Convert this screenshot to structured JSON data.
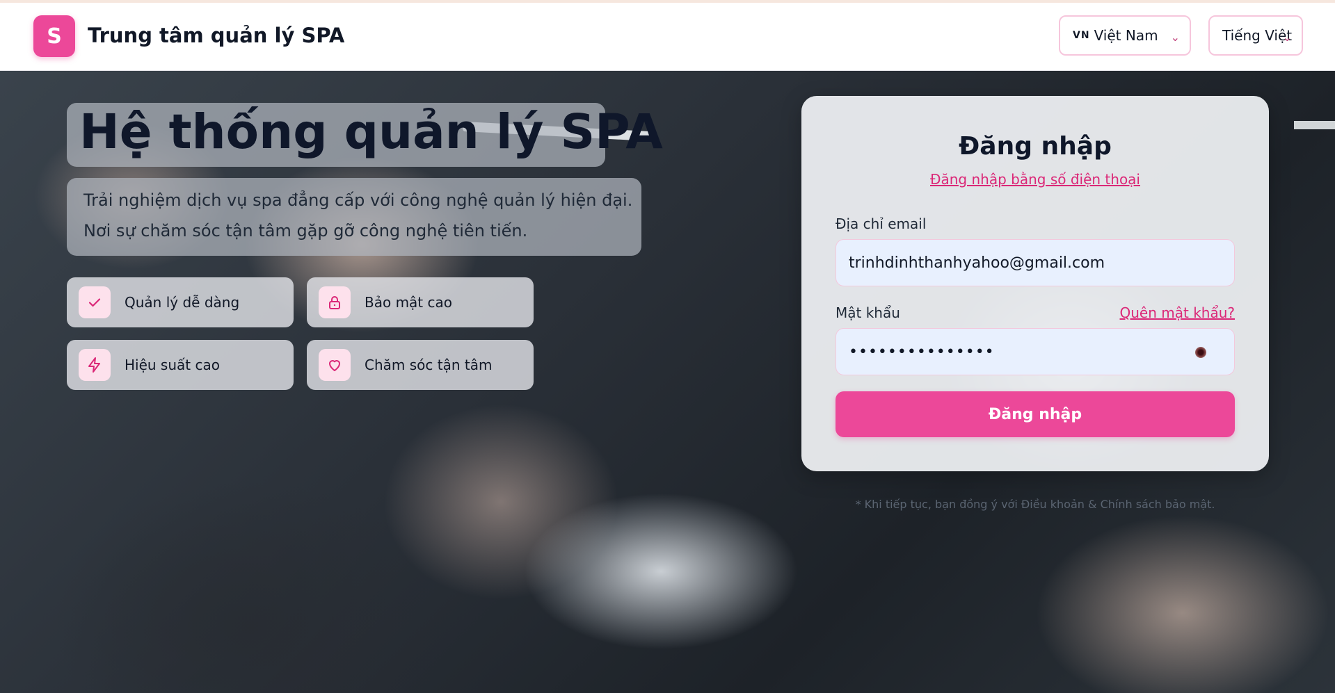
{
  "header": {
    "logo_letter": "S",
    "brand": "Trung tâm quản lý SPA",
    "country_flag": "VN",
    "country": "Việt Nam",
    "language": "Tiếng Việt"
  },
  "hero": {
    "title": "Hệ thống quản lý SPA",
    "subtitle_line1": "Trải nghiệm dịch vụ spa đẳng cấp với công nghệ quản lý hiện đại.",
    "subtitle_line2": "Nơi sự chăm sóc tận tâm gặp gỡ công nghệ tiên tiến.",
    "features": [
      {
        "label": "Quản lý dễ dàng",
        "icon": "check-icon"
      },
      {
        "label": "Bảo mật cao",
        "icon": "lock-icon"
      },
      {
        "label": "Hiệu suất cao",
        "icon": "lightning-icon"
      },
      {
        "label": "Chăm sóc tận tâm",
        "icon": "heart-icon"
      }
    ]
  },
  "login": {
    "title": "Đăng nhập",
    "phone_link": "Đăng nhập bằng số điện thoại",
    "email_label": "Địa chỉ email",
    "email_value": "trinhdinhthanhyahoo@gmail.com",
    "password_label": "Mật khẩu",
    "forgot_link": "Quên mật khẩu?",
    "password_value": "•••••••••••••••",
    "submit_label": "Đăng nhập",
    "terms": "* Khi tiếp tục, bạn đồng ý với Điều khoản & Chính sách bảo mật."
  },
  "colors": {
    "accent": "#ec4899",
    "link": "#db2777",
    "icon_bg": "#fde1ec"
  }
}
